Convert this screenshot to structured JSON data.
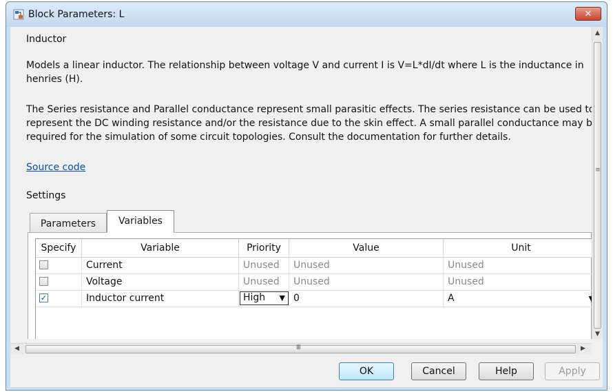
{
  "window": {
    "title": "Block Parameters: L"
  },
  "block": {
    "name": "Inductor",
    "description1": "Models a linear inductor. The relationship between voltage V and current I is V=L*dI/dt where L is the inductance in henries (H).",
    "description2": "The Series resistance and Parallel conductance represent small parasitic effects. The series resistance can be used to represent the DC winding resistance and/or the resistance due to the skin effect. A small parallel conductance may be required for the simulation of some circuit topologies. Consult the documentation for further details.",
    "source_link": "Source code"
  },
  "settings": {
    "label": "Settings",
    "tabs": [
      {
        "label": "Parameters",
        "active": false
      },
      {
        "label": "Variables",
        "active": true
      }
    ]
  },
  "variables_table": {
    "headers": [
      "Specify",
      "Variable",
      "Priority",
      "Value",
      "Unit"
    ],
    "rows": [
      {
        "specify": false,
        "variable": "Current",
        "priority": "Unused",
        "value": "Unused",
        "unit": "Unused"
      },
      {
        "specify": false,
        "variable": "Voltage",
        "priority": "Unused",
        "value": "Unused",
        "unit": "Unused"
      },
      {
        "specify": true,
        "variable": "Inductor current",
        "priority": "High",
        "value": "0",
        "unit": "A"
      }
    ]
  },
  "buttons": {
    "ok": "OK",
    "cancel": "Cancel",
    "help": "Help",
    "apply": "Apply"
  },
  "scrollbar": {
    "h_grip": "III",
    "v_grip": "≡"
  },
  "colors": {
    "link": "#0b4ea5",
    "close_button": "#c7452f"
  }
}
